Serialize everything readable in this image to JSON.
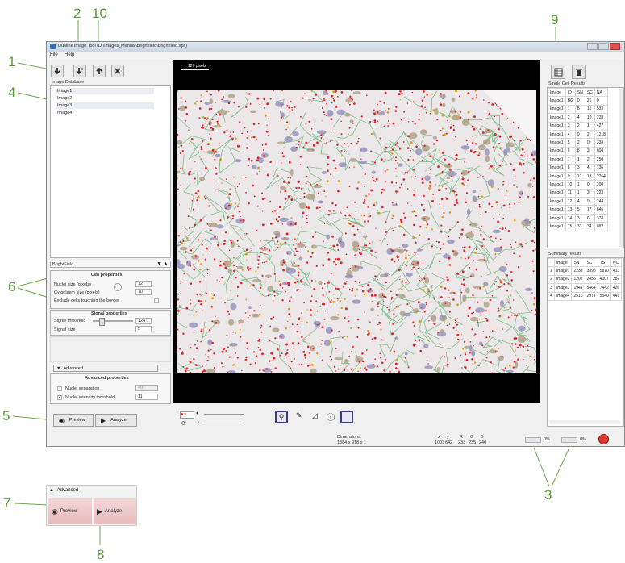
{
  "callouts": [
    "1",
    "2",
    "10",
    "4",
    "6",
    "5",
    "9",
    "3",
    "7",
    "8"
  ],
  "window": {
    "title": "Duolink Image Tool (D:\\Images_Manual\\Brightfield\\Brightfield.xps)",
    "menu": [
      "File",
      "Help"
    ]
  },
  "toolbar": {
    "icons": [
      "import-icon",
      "add-image-icon",
      "export-icon",
      "close-icon"
    ]
  },
  "database": {
    "label": "Image Database",
    "items": [
      "Image1",
      "Image2",
      "Image3",
      "Image4"
    ]
  },
  "settings": {
    "mode": "BrightField",
    "cell_header": "Cell properties",
    "nuclei_size_label": "Nuclei size (pixels)",
    "nuclei_size_value": "12",
    "cytoplasm_label": "Cytoplasm size (pixels)",
    "cytoplasm_value": "70",
    "exclude_label": "Exclude cells touching the border",
    "signal_header": "Signal properties",
    "threshold_label": "Signal threshold",
    "threshold_value": "124",
    "signal_size_label": "Signal size",
    "signal_size_value": "5",
    "advanced_toggle": "Advanced",
    "advanced_header": "Advanced properties",
    "nuclei_sep_label": "Nuclei separation",
    "nuclei_sep_value": "40",
    "nuclei_int_label": "Nuclei intensity threshold",
    "nuclei_int_value": "11",
    "preview": "Preview",
    "analyze": "Analyze"
  },
  "viewer": {
    "scale_label": "127 pixels"
  },
  "statusbar": {
    "dim_label": "Dimensions:",
    "dim_value": "1384 x 918 x 1",
    "coords": [
      "x",
      "y",
      "1003",
      "642"
    ],
    "rgb": [
      "R",
      "G",
      "B",
      "233",
      "235",
      "240"
    ],
    "progress1": "0%",
    "progress2": "0%"
  },
  "single_cell": {
    "label": "Single Cell Results",
    "columns": [
      "Image",
      "ID",
      "SN",
      "SC",
      "NA"
    ],
    "rows": [
      [
        "Image1",
        "BG",
        "0",
        "26",
        "0"
      ],
      [
        "Image1",
        "1",
        "8",
        "15",
        "533"
      ],
      [
        "Image1",
        "2",
        "4",
        "10",
        "228"
      ],
      [
        "Image1",
        "3",
        "2",
        "1",
        "427"
      ],
      [
        "Image1",
        "4",
        "9",
        "2",
        "1218"
      ],
      [
        "Image1",
        "5",
        "2",
        "0",
        "338"
      ],
      [
        "Image1",
        "6",
        "8",
        "3",
        "604"
      ],
      [
        "Image1",
        "7",
        "1",
        "2",
        "250"
      ],
      [
        "Image1",
        "8",
        "3",
        "4",
        "136"
      ],
      [
        "Image1",
        "9",
        "12",
        "13",
        "2264"
      ],
      [
        "Image1",
        "10",
        "1",
        "0",
        "208"
      ],
      [
        "Image1",
        "11",
        "1",
        "3",
        "223"
      ],
      [
        "Image1",
        "12",
        "4",
        "9",
        "244"
      ],
      [
        "Image1",
        "13",
        "5",
        "17",
        "845"
      ],
      [
        "Image1",
        "14",
        "3",
        "6",
        "378"
      ],
      [
        "Image1",
        "15",
        "33",
        "34",
        "882"
      ]
    ]
  },
  "summary": {
    "label": "Summary results",
    "columns": [
      "",
      "Image",
      "SN",
      "SC",
      "TS",
      "NC"
    ],
    "rows": [
      [
        "1",
        "Image1",
        "2238",
        "3396",
        "5870",
        "413"
      ],
      [
        "2",
        "Image2",
        "1202",
        "2855",
        "4007",
        "387"
      ],
      [
        "3",
        "Image3",
        "1944",
        "5464",
        "7442",
        "426"
      ],
      [
        "4",
        "Image4",
        "2516",
        "2974",
        "5540",
        "441"
      ]
    ]
  },
  "zoom": {
    "advanced": "Advanced",
    "preview": "Preview",
    "analyze": "Analyze"
  }
}
